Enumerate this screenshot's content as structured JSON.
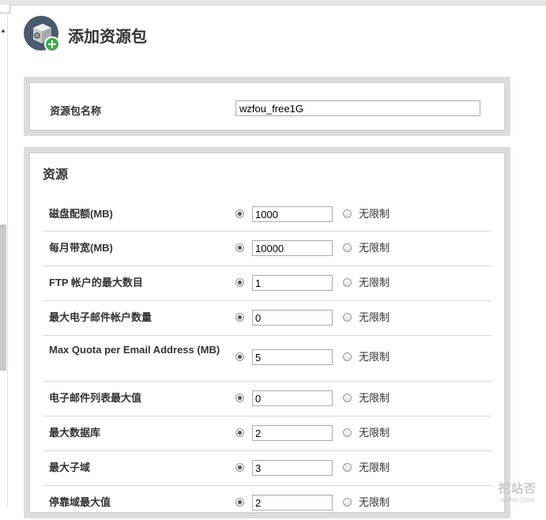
{
  "page": {
    "title": "添加资源包"
  },
  "package": {
    "name_label": "资源包名称",
    "name_value": "wzfou_free1G"
  },
  "resources": {
    "title": "资源",
    "unlimited_label": "无限制",
    "rows": [
      {
        "label": "磁盘配额(MB)",
        "value": "1000"
      },
      {
        "label": "每月带宽(MB)",
        "value": "10000"
      },
      {
        "label": "FTP 帐户的最大数目",
        "value": "1"
      },
      {
        "label": "最大电子邮件帐户数量",
        "value": "0"
      },
      {
        "label": "Max Quota per Email Address (MB)",
        "value": "5"
      },
      {
        "label": "电子邮件列表最大值",
        "value": "0"
      },
      {
        "label": "最大数据库",
        "value": "2"
      },
      {
        "label": "最大子域",
        "value": "3"
      },
      {
        "label": "停靠域最大值",
        "value": "2"
      }
    ]
  },
  "watermark": {
    "line1": "挖站否",
    "line2": "wzfou.com"
  },
  "icons": {
    "header": "package-add-icon",
    "left": "caret-up-icon"
  },
  "colors": {
    "icon_circle": "#4a5b70",
    "add_badge": "#3ea84a",
    "panel": "#dcdcdc"
  }
}
